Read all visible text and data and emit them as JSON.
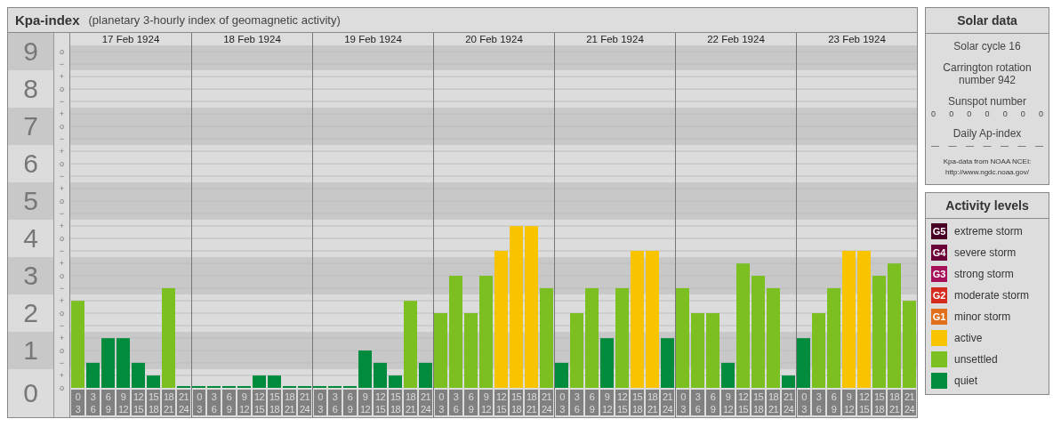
{
  "header": {
    "title": "Kpa-index",
    "subtitle": "(planetary 3-hourly index of geomagnetic activity)"
  },
  "chart": {
    "day_labels": [
      "17 Feb 1924",
      "18 Feb 1924",
      "19 Feb 1924",
      "20 Feb 1924",
      "21 Feb 1924",
      "22 Feb 1924",
      "23 Feb 1924"
    ],
    "minor_tick_labels": [
      "o",
      "−",
      "+",
      "o",
      "−",
      "+",
      "o",
      "−",
      "+",
      "o",
      "−",
      "+",
      "o",
      "−",
      "+",
      "o",
      "−",
      "+",
      "o",
      "−",
      "+",
      "o",
      "−",
      "+",
      "o",
      "−",
      "+",
      "o"
    ],
    "chart_data": {
      "type": "bar",
      "grid": true,
      "categories": [
        "0 3",
        "3 6",
        "6 9",
        "9 12",
        "12 15",
        "15 18",
        "18 21",
        "21 24",
        "0 3",
        "3 6",
        "6 9",
        "9 12",
        "12 15",
        "15 18",
        "18 21",
        "21 24",
        "0 3",
        "3 6",
        "6 9",
        "9 12",
        "12 15",
        "15 18",
        "18 21",
        "21 24",
        "0 3",
        "3 6",
        "6 9",
        "9 12",
        "12 15",
        "15 18",
        "18 21",
        "21 24",
        "0 3",
        "3 6",
        "6 9",
        "9 12",
        "12 15",
        "15 18",
        "18 21",
        "21 24",
        "0 3",
        "3 6",
        "6 9",
        "9 12",
        "12 15",
        "15 18",
        "18 21",
        "21 24",
        "0 3",
        "3 6",
        "6 9",
        "9 12",
        "12 15",
        "15 18",
        "18 21",
        "21 24"
      ],
      "ylim": [
        0,
        9.17
      ],
      "yticks": [
        {
          "value": 0,
          "label": "0"
        },
        {
          "value": 1,
          "label": "1"
        },
        {
          "value": 2,
          "label": "2"
        },
        {
          "value": 3,
          "label": "3"
        },
        {
          "value": 4,
          "label": "4"
        },
        {
          "value": 5,
          "label": "5"
        },
        {
          "value": 6,
          "label": "6"
        },
        {
          "value": 7,
          "label": "7"
        },
        {
          "value": 8,
          "label": "8"
        },
        {
          "value": 9,
          "label": "9"
        }
      ],
      "series": [
        {
          "name": "active",
          "color": "#f8c400",
          "values": [
            null,
            null,
            null,
            null,
            null,
            null,
            null,
            null,
            null,
            null,
            null,
            null,
            null,
            null,
            null,
            null,
            null,
            null,
            null,
            null,
            null,
            null,
            null,
            null,
            null,
            null,
            null,
            null,
            3.67,
            4.33,
            4.33,
            null,
            null,
            null,
            null,
            null,
            null,
            3.67,
            3.67,
            null,
            null,
            null,
            null,
            null,
            null,
            null,
            null,
            null,
            null,
            null,
            null,
            3.67,
            3.67,
            null,
            null,
            null
          ]
        },
        {
          "name": "unsettled",
          "color": "#7bbf21",
          "values": [
            2.33,
            null,
            null,
            null,
            null,
            null,
            2.67,
            null,
            null,
            null,
            null,
            null,
            null,
            null,
            null,
            null,
            null,
            null,
            null,
            null,
            null,
            null,
            2.33,
            null,
            2,
            3,
            2,
            3,
            null,
            null,
            null,
            2.67,
            null,
            2,
            2.67,
            null,
            2.67,
            null,
            null,
            null,
            2.67,
            2,
            2,
            null,
            3.33,
            3,
            2.67,
            null,
            null,
            2,
            2.67,
            null,
            null,
            3,
            3.33,
            2.33
          ]
        },
        {
          "name": "quiet",
          "color": "#008c3c",
          "values": [
            null,
            0.67,
            1.33,
            1.33,
            0.67,
            0.33,
            null,
            0,
            0,
            0,
            0,
            0,
            0.33,
            0.33,
            0,
            0,
            0,
            0,
            0,
            1,
            0.67,
            0.33,
            null,
            0.67,
            null,
            null,
            null,
            null,
            null,
            null,
            null,
            null,
            0.67,
            null,
            null,
            1.33,
            null,
            null,
            null,
            1.33,
            null,
            null,
            null,
            0.67,
            null,
            null,
            null,
            0.33,
            1.33,
            null,
            null,
            null,
            null,
            null,
            null,
            null
          ]
        }
      ]
    }
  },
  "solar_data": {
    "title": "Solar data",
    "solar_cycle": "Solar cycle 16",
    "carrington": "Carrington rotation number 942",
    "sunspot_label": "Sunspot number",
    "sunspot_values": [
      "0",
      "0",
      "0",
      "0",
      "0",
      "0",
      "0"
    ],
    "ap_label": "Daily Ap-index",
    "ap_values": [
      "—",
      "—",
      "—",
      "—",
      "—",
      "—",
      "—"
    ],
    "source": "Kpa-data from NOAA NCEI:",
    "source_url": "http://www.ngdc.noaa.gov/"
  },
  "activity_levels": {
    "title": "Activity levels",
    "items": [
      {
        "badge": "G5",
        "label": "extreme storm",
        "color": "#4a0025"
      },
      {
        "badge": "G4",
        "label": "severe storm",
        "color": "#6b0038"
      },
      {
        "badge": "G3",
        "label": "strong storm",
        "color": "#a5115a"
      },
      {
        "badge": "G2",
        "label": "moderate storm",
        "color": "#d42a1e"
      },
      {
        "badge": "G1",
        "label": "minor storm",
        "color": "#e0701c"
      }
    ]
  }
}
